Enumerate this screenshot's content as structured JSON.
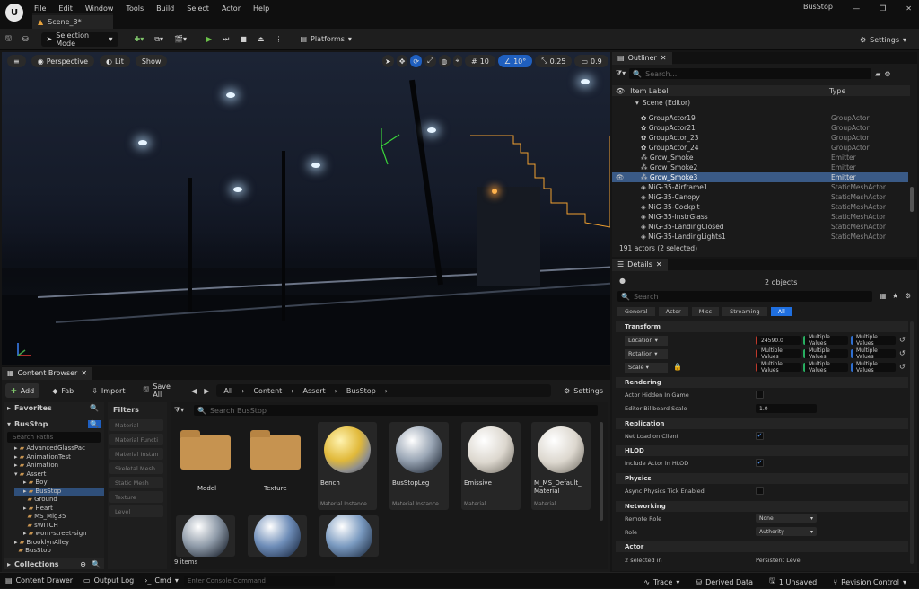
{
  "window": {
    "title": "BusStop",
    "doc_tab": "Scene_3*"
  },
  "menu": [
    "File",
    "Edit",
    "Window",
    "Tools",
    "Build",
    "Select",
    "Actor",
    "Help"
  ],
  "toolbar": {
    "selection_mode": "Selection Mode",
    "platforms": "Platforms",
    "settings": "Settings"
  },
  "viewport": {
    "perspective": "Perspective",
    "lit": "Lit",
    "show": "Show",
    "grid": "10",
    "angle": "10°",
    "scale": "0.25",
    "camera": "0.9"
  },
  "content_browser": {
    "tab": "Content Browser",
    "add": "Add",
    "fab": "Fab",
    "import": "Import",
    "save_all": "Save All",
    "breadcrumb": [
      "All",
      "Content",
      "Assert",
      "BusStop"
    ],
    "settings": "Settings",
    "favorites": "Favorites",
    "root": "BusStop",
    "search_paths": "Search Paths",
    "filters_title": "Filters",
    "search_placeholder": "Search BusStop",
    "item_count": "9 items",
    "collections": "Collections",
    "tree": [
      "AdvancedGlassPac",
      "AnimationTest",
      "Animation",
      "Assert",
      "Boy",
      "BusStop",
      "Ground",
      "Heart",
      "MS_Mig35",
      "sWITCH",
      "worn-street-sign",
      "BrooklynAlley",
      "BusStop"
    ],
    "filters": [
      "Material",
      "Material Functi",
      "Material Instan",
      "Skeletal Mesh",
      "Static Mesh",
      "Texture",
      "Level"
    ],
    "assets": [
      {
        "name": "Model",
        "type": ""
      },
      {
        "name": "Texture",
        "type": ""
      },
      {
        "name": "Bench",
        "type": "Material Instance"
      },
      {
        "name": "BusStopLeg",
        "type": "Material Instance"
      },
      {
        "name": "Emissive",
        "type": "Material"
      },
      {
        "name": "M_MS_Default_ Material",
        "type": "Material"
      }
    ]
  },
  "outliner": {
    "tab": "Outliner",
    "search": "Search...",
    "col_label": "Item Label",
    "col_type": "Type",
    "scene": "Scene (Editor)",
    "footer": "191 actors (2 selected)",
    "rows": [
      {
        "label": "GroupActor19",
        "type": "GroupActor"
      },
      {
        "label": "GroupActor21",
        "type": "GroupActor"
      },
      {
        "label": "GroupActor_23",
        "type": "GroupActor"
      },
      {
        "label": "GroupActor_24",
        "type": "GroupActor"
      },
      {
        "label": "Grow_Smoke",
        "type": "Emitter"
      },
      {
        "label": "Grow_Smoke2",
        "type": "Emitter"
      },
      {
        "label": "Grow_Smoke3",
        "type": "Emitter"
      },
      {
        "label": "MiG-35-Airframe1",
        "type": "StaticMeshActor"
      },
      {
        "label": "MiG-35-Canopy",
        "type": "StaticMeshActor"
      },
      {
        "label": "MiG-35-Cockpit",
        "type": "StaticMeshActor"
      },
      {
        "label": "MiG-35-InstrGlass",
        "type": "StaticMeshActor"
      },
      {
        "label": "MiG-35-LandingClosed",
        "type": "StaticMeshActor"
      },
      {
        "label": "MiG-35-LandingLights1",
        "type": "StaticMeshActor"
      }
    ]
  },
  "details": {
    "tab": "Details",
    "objects": "2 objects",
    "search": "Search",
    "filters": [
      "General",
      "Actor",
      "Misc",
      "Streaming",
      "All"
    ],
    "transform": "Transform",
    "location": "Location",
    "rotation": "Rotation",
    "scale": "Scale",
    "loc_x": "24590.0",
    "multiple": "Multiple Values",
    "rendering": "Rendering",
    "actor_hidden": "Actor Hidden In Game",
    "billboard": "Editor Billboard Scale",
    "billboard_val": "1.0",
    "replication": "Replication",
    "net_load": "Net Load on Client",
    "hlod": "HLOD",
    "include_hlod": "Include Actor in HLOD",
    "physics": "Physics",
    "async_tick": "Async Physics Tick Enabled",
    "networking": "Networking",
    "remote_role": "Remote Role",
    "remote_role_val": "None",
    "role": "Role",
    "role_val": "Authority",
    "actor": "Actor",
    "selected_in": "2 selected in",
    "persistent": "Persistent Level"
  },
  "status": {
    "drawer": "Content Drawer",
    "output": "Output Log",
    "cmd": "Cmd",
    "console": "Enter Console Command",
    "trace": "Trace",
    "derived": "Derived Data",
    "unsaved": "1 Unsaved",
    "revision": "Revision Control"
  }
}
